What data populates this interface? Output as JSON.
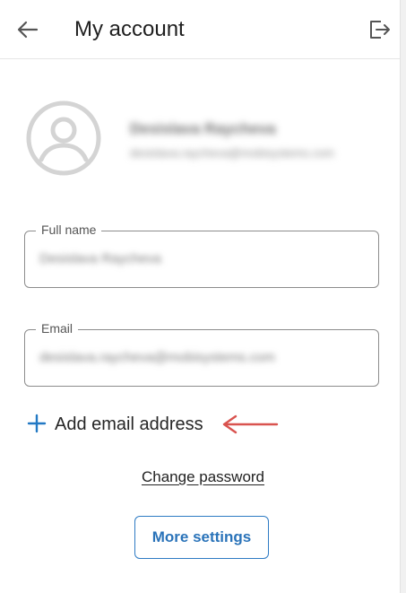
{
  "header": {
    "title": "My account",
    "back_icon": "arrow-left-icon",
    "logout_icon": "logout-icon"
  },
  "profile": {
    "avatar_icon": "user-avatar-icon",
    "name": "Desislava Raycheva",
    "email": "desislava.raycheva@mobisystems.com"
  },
  "form": {
    "full_name": {
      "label": "Full name",
      "value": "Desislava Raycheva"
    },
    "email": {
      "label": "Email",
      "value": "desislava.raycheva@mobisystems.com"
    }
  },
  "actions": {
    "add_email_icon": "plus-icon",
    "add_email": "Add email address",
    "change_password": "Change password",
    "more_settings": "More settings"
  },
  "colors": {
    "accent": "#2379c4",
    "annotation_arrow": "#d9534f"
  }
}
